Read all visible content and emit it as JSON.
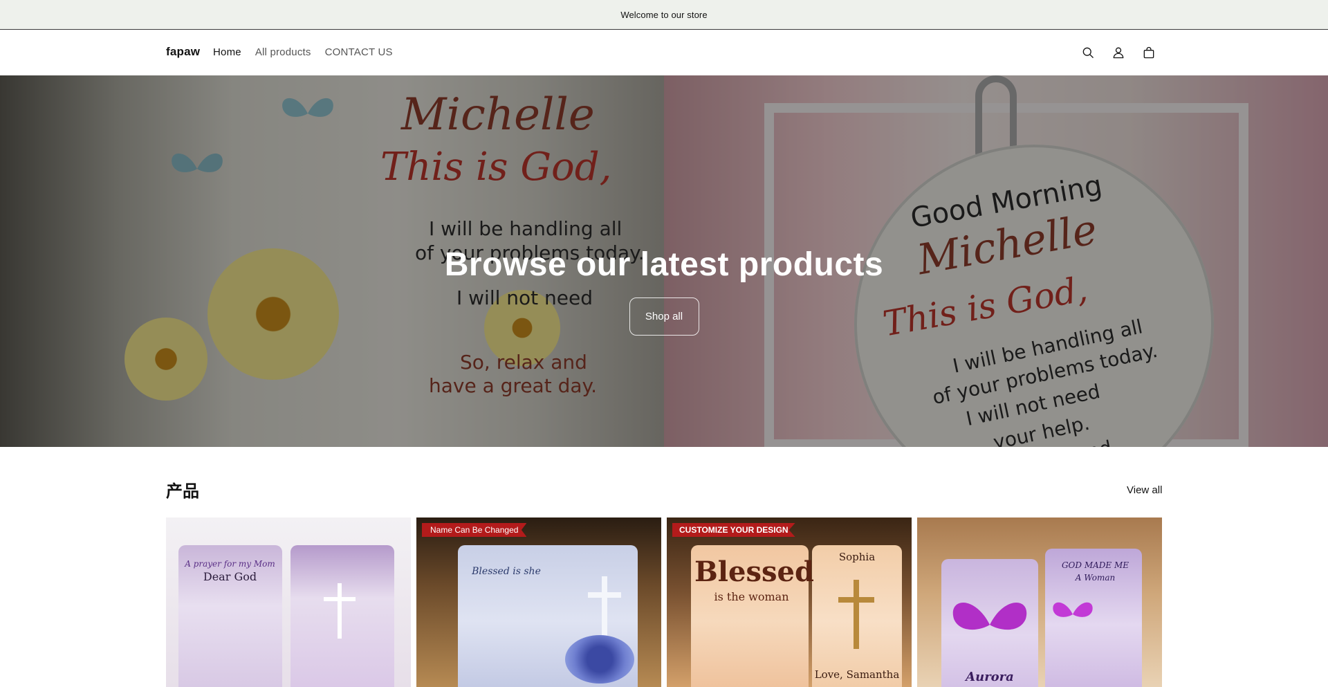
{
  "announcement": {
    "text": "Welcome to our store"
  },
  "header": {
    "logo": "fapaw",
    "nav": [
      {
        "label": "Home"
      },
      {
        "label": "All products"
      },
      {
        "label": "CONTACT US"
      }
    ],
    "icons": [
      "search-icon",
      "account-icon",
      "cart-icon"
    ]
  },
  "hero": {
    "title": "Browse our latest products",
    "button": "Shop all",
    "art": {
      "left_name": "Michelle",
      "left_heading": "This is God,",
      "left_line1": "I will be handling all",
      "left_line2": "of your problems today.",
      "left_line3": "I will not need",
      "left_line4": "So, relax and",
      "left_line5": "have a great day.",
      "right_top": "Good Morning",
      "right_name": "Michelle",
      "right_heading": "This is God,",
      "right_line1": "I will be handling all",
      "right_line2": "of your problems today.",
      "right_line3": "I will not need",
      "right_line4": "your help.",
      "right_line5": "So, relax and"
    }
  },
  "products": {
    "title": "产品",
    "view_all": "View all",
    "cards": [
      {
        "tag": "",
        "caption_lines": [
          "A prayer for my Mom",
          "Dear God"
        ]
      },
      {
        "tag": "Name Can Be Changed",
        "caption_lines": [
          "Blessed is she"
        ]
      },
      {
        "tag": "CUSTOMIZE YOUR DESIGN",
        "caption_lines": [
          "Blessed",
          "is the woman"
        ],
        "name": "Sophia",
        "sign": "Love, Samantha"
      },
      {
        "tag": "",
        "caption_lines": [
          "GOD MADE ME",
          "A Woman"
        ],
        "name": "Aurora"
      }
    ]
  }
}
